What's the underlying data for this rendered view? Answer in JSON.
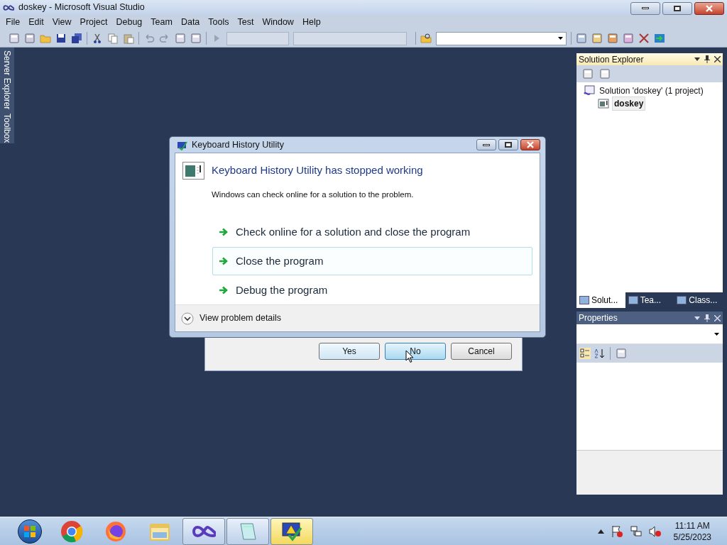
{
  "window": {
    "title": "doskey - Microsoft Visual Studio"
  },
  "menu": [
    "File",
    "Edit",
    "View",
    "Project",
    "Debug",
    "Team",
    "Data",
    "Tools",
    "Test",
    "Window",
    "Help"
  ],
  "side_tabs": [
    "Server Explorer",
    "Toolbox"
  ],
  "solution_explorer": {
    "title": "Solution Explorer",
    "tree": [
      {
        "label": "Solution 'doskey' (1 project)",
        "selected": false,
        "children": [
          {
            "label": "doskey",
            "selected": true
          }
        ]
      }
    ],
    "tabs": [
      {
        "label": "Solut...",
        "selected": true
      },
      {
        "label": "Tea...",
        "selected": false
      },
      {
        "label": "Class...",
        "selected": false
      }
    ]
  },
  "properties": {
    "title": "Properties"
  },
  "back_dialog": {
    "buttons": [
      {
        "label": "Yes",
        "selected": false
      },
      {
        "label": "No",
        "selected": true
      },
      {
        "label": "Cancel",
        "selected": false
      }
    ]
  },
  "crash_dialog": {
    "title": "Keyboard History Utility",
    "heading": "Keyboard History Utility has stopped working",
    "message": "Windows can check online for a solution to the problem.",
    "options": [
      {
        "label": "Check online for a solution and close the program",
        "selected": false
      },
      {
        "label": "Close the program",
        "selected": true
      },
      {
        "label": "Debug the program",
        "selected": false
      }
    ],
    "details": {
      "label": "View problem details",
      "expanded": false
    }
  },
  "taskbar": {
    "apps": [
      {
        "kind": "chrome",
        "open": false,
        "selected": false
      },
      {
        "kind": "firefox",
        "open": false,
        "selected": false
      },
      {
        "kind": "folder",
        "open": false,
        "selected": false
      },
      {
        "kind": "studio",
        "open": true,
        "selected": false
      },
      {
        "kind": "notepad",
        "open": true,
        "selected": false
      },
      {
        "kind": "error",
        "open": true,
        "selected": true
      }
    ],
    "time": "11:11 AM",
    "date": "5/25/2023"
  }
}
